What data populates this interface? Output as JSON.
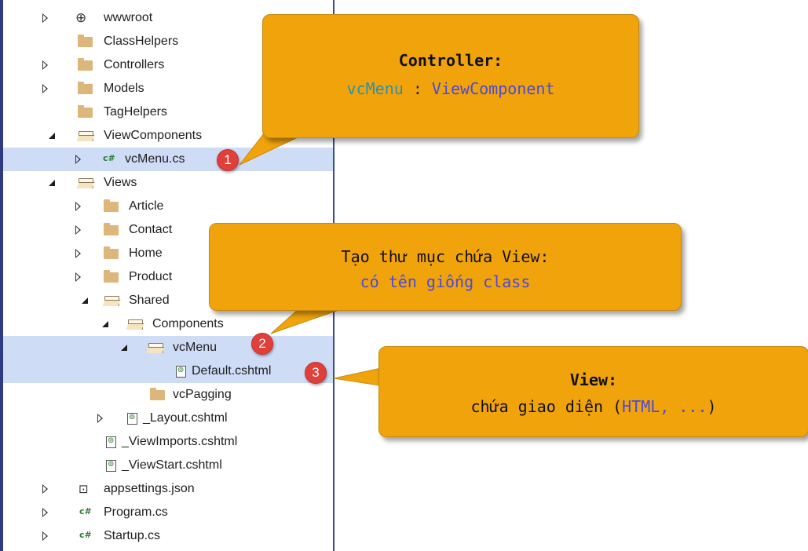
{
  "tree": {
    "wwwroot": "wwwroot",
    "classhelpers": "ClassHelpers",
    "controllers": "Controllers",
    "models": "Models",
    "taghelpers": "TagHelpers",
    "viewcomponents": "ViewComponents",
    "vcmenu_cs": "vcMenu.cs",
    "views": "Views",
    "article": "Article",
    "contact": "Contact",
    "home": "Home",
    "product": "Product",
    "shared": "Shared",
    "components": "Components",
    "vcmenu": "vcMenu",
    "default_cshtml": "Default.cshtml",
    "vcpagging": "vcPagging",
    "layout_cshtml": "_Layout.cshtml",
    "viewimports": "_ViewImports.cshtml",
    "viewstart": "_ViewStart.cshtml",
    "appsettings": "appsettings.json",
    "program": "Program.cs",
    "startup": "Startup.cs",
    "cs_icon": "c#"
  },
  "callouts": {
    "controller": {
      "title": "Controller:",
      "name": "vcMenu",
      "sep": " : ",
      "base": "ViewComponent"
    },
    "folder": {
      "line1": "Tạo thư mục chứa View:",
      "line2": "có tên giống class"
    },
    "view": {
      "title": "View:",
      "line_prefix": "chứa giao diện (",
      "line_html": "HTML, ...",
      "line_suffix": ")"
    }
  },
  "badges": [
    "1",
    "2",
    "3"
  ],
  "colors": {
    "callout_bg": "#f0a30a",
    "badge_red": "#e0403a",
    "selection": "#cfdcf6",
    "folder": "#dcb67a",
    "teal_text": "#2b91af",
    "blue_text": "#4a4adc"
  }
}
